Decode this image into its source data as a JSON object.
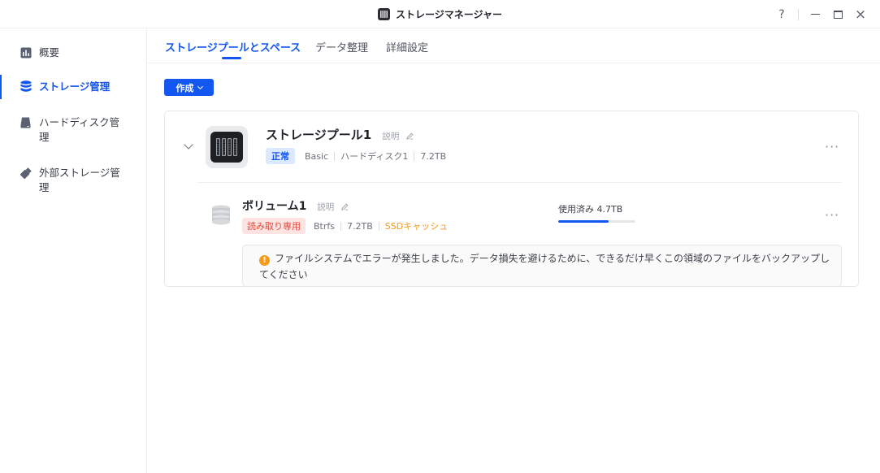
{
  "window": {
    "title": "ストレージマネージャー",
    "controls": {
      "help": "?",
      "minimize": "minimize",
      "maximize": "maximize",
      "close": "×"
    }
  },
  "sidebar": {
    "items": [
      {
        "label": "概要",
        "icon": "chart-icon",
        "active": false
      },
      {
        "label": "ストレージ管理",
        "icon": "database-icon",
        "active": true
      },
      {
        "label": "ハードディスク管理",
        "icon": "hard-disk-icon",
        "active": false
      },
      {
        "label": "外部ストレージ管理",
        "icon": "usb-drive-icon",
        "active": false
      }
    ]
  },
  "tabs": [
    {
      "label": "ストレージプールとスペース",
      "active": true
    },
    {
      "label": "データ整理",
      "active": false
    },
    {
      "label": "詳細設定",
      "active": false
    }
  ],
  "toolbar": {
    "create_label": "作成"
  },
  "pool": {
    "name": "ストレージプール1",
    "description_link": "説明",
    "status": "正常",
    "type": "Basic",
    "disks": "ハードディスク1",
    "size": "7.2TB",
    "more": "···"
  },
  "volume": {
    "name": "ボリューム1",
    "description_link": "説明",
    "status": "読み取り専用",
    "filesystem": "Btrfs",
    "size": "7.2TB",
    "cache": "SSDキャッシュ",
    "usage_label": "使用済み 4.7TB",
    "usage_fraction": 0.65,
    "more": "···"
  },
  "alert": {
    "icon": "!",
    "message": "ファイルシステムでエラーが発生しました。データ損失を避けるために、できるだけ早くこの領域のファイルをバックアップしてください"
  },
  "colors": {
    "accent": "#1456f0",
    "warning": "#f59a1b",
    "error": "#e8483c"
  }
}
